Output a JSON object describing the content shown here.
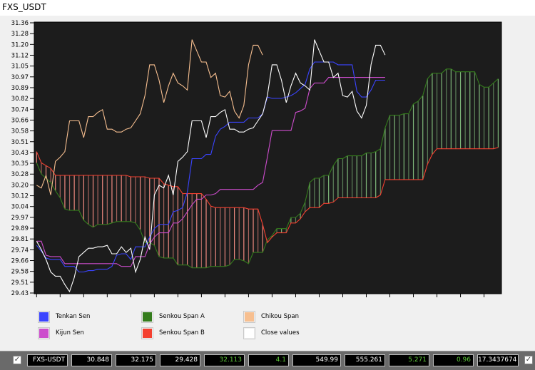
{
  "window": {
    "title": "FXS_USDT"
  },
  "colors": {
    "tenkan": "#3a44ff",
    "kijun": "#cc4ccc",
    "senkou_a": "#347c1c",
    "senkou_b": "#f44030",
    "chikou": "#f7bf90",
    "close": "#ffffff",
    "plot_bg": "#1c1c1c",
    "cloud_bullish": "#7fb87a",
    "cloud_bearish": "#f08a80",
    "value_green": "#5ec83a"
  },
  "chart_data": {
    "type": "line",
    "title": "",
    "xlabel": "",
    "ylabel": "",
    "xlim": [
      -0.5,
      98.7
    ],
    "ylim": [
      29.43,
      31.36
    ],
    "grid": false,
    "legend_placement": "bottom",
    "x_ticks": [
      "0",
      "5",
      "10",
      "15",
      "20",
      "25",
      "30",
      "35",
      "40",
      "45",
      "50",
      "55",
      "60",
      "65",
      "70",
      "75",
      "80",
      "85",
      "90",
      "95"
    ],
    "y_ticks": [
      "31.36",
      "31.28",
      "31.20",
      "31.12",
      "31.05",
      "30.97",
      "30.89",
      "30.82",
      "30.74",
      "30.66",
      "30.58",
      "30.51",
      "30.43",
      "30.35",
      "30.28",
      "30.20",
      "30.12",
      "30.04",
      "29.97",
      "29.89",
      "29.81",
      "29.74",
      "29.66",
      "29.58",
      "29.51",
      "29.43"
    ],
    "series": [
      {
        "name": "Tenkan Sen",
        "key": "tenkan",
        "x_start": 0,
        "values": [
          29.77,
          29.73,
          29.68,
          29.67,
          29.67,
          29.67,
          29.62,
          29.62,
          29.62,
          29.58,
          29.58,
          29.59,
          29.59,
          29.6,
          29.6,
          29.6,
          29.62,
          29.7,
          29.71,
          29.71,
          29.67,
          29.76,
          29.76,
          29.76,
          29.83,
          29.89,
          29.92,
          29.92,
          29.92,
          30.01,
          30.02,
          30.04,
          30.15,
          30.39,
          30.39,
          30.39,
          30.42,
          30.42,
          30.55,
          30.6,
          30.62,
          30.65,
          30.65,
          30.65,
          30.65,
          30.68,
          30.68,
          30.68,
          30.71,
          30.83,
          30.82,
          30.82,
          30.82,
          30.83,
          30.84,
          30.86,
          30.89,
          30.92,
          31.03,
          31.08,
          31.08,
          31.08,
          31.08,
          31.08,
          31.06,
          31.06,
          31.06,
          31.06,
          30.87,
          30.83,
          30.83,
          30.88,
          30.95,
          30.95,
          30.95
        ]
      },
      {
        "name": "Kijun Sen",
        "key": "kijun",
        "x_start": 0,
        "values": [
          29.8,
          29.8,
          29.7,
          29.69,
          29.69,
          29.69,
          29.64,
          29.64,
          29.64,
          29.64,
          29.64,
          29.64,
          29.64,
          29.64,
          29.64,
          29.64,
          29.64,
          29.64,
          29.62,
          29.62,
          29.62,
          29.69,
          29.69,
          29.69,
          29.78,
          29.83,
          29.86,
          29.86,
          29.86,
          29.93,
          29.93,
          29.96,
          30.01,
          30.06,
          30.1,
          30.1,
          30.13,
          30.13,
          30.14,
          30.17,
          30.17,
          30.17,
          30.17,
          30.17,
          30.17,
          30.17,
          30.17,
          30.2,
          30.22,
          30.4,
          30.59,
          30.59,
          30.59,
          30.59,
          30.59,
          30.72,
          30.73,
          30.75,
          30.89,
          30.93,
          30.93,
          30.93,
          30.97,
          30.97,
          30.97,
          30.97,
          30.97,
          30.97,
          30.97,
          30.97,
          30.97,
          30.97,
          30.97,
          30.97,
          30.97
        ]
      },
      {
        "name": "Senkou Span A",
        "key": "senkou_a",
        "x_start": 0,
        "values": [
          30.36,
          30.28,
          30.25,
          30.22,
          30.16,
          30.11,
          30.03,
          30.02,
          30.02,
          30.02,
          29.95,
          29.92,
          29.9,
          29.92,
          29.92,
          29.92,
          29.93,
          29.94,
          29.94,
          29.94,
          29.94,
          29.93,
          29.88,
          29.79,
          29.79,
          29.77,
          29.69,
          29.68,
          29.68,
          29.68,
          29.63,
          29.63,
          29.63,
          29.61,
          29.61,
          29.61,
          29.61,
          29.62,
          29.62,
          29.62,
          29.62,
          29.63,
          29.67,
          29.67,
          29.66,
          29.64,
          29.72,
          29.72,
          29.72,
          29.81,
          29.84,
          29.89,
          29.89,
          29.89,
          29.97,
          29.97,
          30.0,
          30.08,
          30.22,
          30.25,
          30.25,
          30.27,
          30.27,
          30.34,
          30.39,
          30.39,
          30.41,
          30.41,
          30.41,
          30.41,
          30.43,
          30.43,
          30.44,
          30.46,
          30.61,
          30.7,
          30.7,
          30.7,
          30.71,
          30.71,
          30.78,
          30.8,
          30.84,
          30.96,
          31.0,
          31.0,
          31.0,
          31.03,
          31.03,
          31.01,
          31.01,
          31.01,
          31.01,
          31.01,
          30.92,
          30.9,
          30.9,
          30.93,
          30.96
        ]
      },
      {
        "name": "Senkou Span B",
        "key": "senkou_b",
        "x_start": 0,
        "values": [
          30.44,
          30.36,
          30.34,
          30.32,
          30.27,
          30.27,
          30.27,
          30.27,
          30.27,
          30.27,
          30.27,
          30.27,
          30.27,
          30.27,
          30.27,
          30.27,
          30.27,
          30.27,
          30.27,
          30.27,
          30.26,
          30.26,
          30.26,
          30.26,
          30.25,
          30.25,
          30.25,
          30.21,
          30.2,
          30.19,
          30.19,
          30.14,
          30.14,
          30.14,
          30.14,
          30.14,
          30.1,
          30.05,
          30.04,
          30.04,
          30.04,
          30.04,
          30.04,
          30.04,
          30.04,
          30.03,
          30.03,
          30.03,
          29.92,
          29.79,
          29.83,
          29.86,
          29.86,
          29.86,
          29.93,
          29.93,
          29.96,
          30.01,
          30.04,
          30.04,
          30.04,
          30.07,
          30.07,
          30.08,
          30.11,
          30.11,
          30.11,
          30.11,
          30.11,
          30.11,
          30.11,
          30.11,
          30.11,
          30.13,
          30.24,
          30.24,
          30.24,
          30.24,
          30.24,
          30.24,
          30.24,
          30.24,
          30.24,
          30.35,
          30.42,
          30.46,
          30.46,
          30.46,
          30.46,
          30.46,
          30.46,
          30.46,
          30.46,
          30.46,
          30.46,
          30.46,
          30.46,
          30.46,
          30.47
        ]
      },
      {
        "name": "Chikou Span",
        "key": "chikou",
        "x_start": 0,
        "values": [
          30.2,
          30.18,
          30.27,
          30.13,
          30.37,
          30.4,
          30.44,
          30.66,
          30.66,
          30.66,
          30.54,
          30.69,
          30.69,
          30.72,
          30.74,
          30.6,
          30.6,
          30.58,
          30.58,
          30.6,
          30.61,
          30.66,
          30.71,
          30.84,
          31.06,
          31.06,
          30.95,
          30.79,
          30.91,
          31.0,
          30.93,
          30.91,
          30.88,
          31.24,
          31.16,
          31.08,
          31.08,
          30.97,
          31.0,
          30.84,
          30.83,
          30.87,
          30.73,
          30.68,
          30.77,
          31.06,
          31.2,
          31.2,
          31.13
        ]
      },
      {
        "name": "Close values",
        "key": "close",
        "x_start": 0,
        "values": [
          29.8,
          29.74,
          29.67,
          29.58,
          29.55,
          29.55,
          29.49,
          29.44,
          29.54,
          29.69,
          29.72,
          29.75,
          29.75,
          29.76,
          29.76,
          29.77,
          29.71,
          29.71,
          29.76,
          29.72,
          29.75,
          29.58,
          29.67,
          29.83,
          29.74,
          30.13,
          30.2,
          30.18,
          30.27,
          30.13,
          30.37,
          30.4,
          30.44,
          30.66,
          30.66,
          30.66,
          30.54,
          30.69,
          30.69,
          30.72,
          30.74,
          30.6,
          30.6,
          30.58,
          30.58,
          30.6,
          30.61,
          30.66,
          30.71,
          30.84,
          31.06,
          31.06,
          30.95,
          30.79,
          30.91,
          31.0,
          30.93,
          30.91,
          30.88,
          31.24,
          31.16,
          31.08,
          31.08,
          30.97,
          31.0,
          30.84,
          30.83,
          30.87,
          30.73,
          30.68,
          30.77,
          31.06,
          31.2,
          31.2,
          31.13
        ]
      }
    ]
  },
  "legend": [
    {
      "label": "Tenkan Sen",
      "key": "tenkan"
    },
    {
      "label": "Kijun Sen",
      "key": "kijun"
    },
    {
      "label": "Senkou Span A",
      "key": "senkou_a"
    },
    {
      "label": "Senkou Span B",
      "key": "senkou_b"
    },
    {
      "label": "Chikou Span",
      "key": "chikou"
    },
    {
      "label": "Close values",
      "key": "close"
    }
  ],
  "bottom_bar": {
    "left_checkbox_checked": true,
    "right_checkbox_checked": true,
    "fields": [
      {
        "value": "FXS-USDT",
        "green": false
      },
      {
        "value": "30.848",
        "green": false
      },
      {
        "value": "32.175",
        "green": false
      },
      {
        "value": "29.428",
        "green": false
      },
      {
        "value": "32.113",
        "green": true
      },
      {
        "value": "4.1",
        "green": true
      },
      {
        "value": "549.99",
        "green": false
      },
      {
        "value": "555.261",
        "green": false
      },
      {
        "value": "5.271",
        "green": true
      },
      {
        "value": "0.96",
        "green": true
      },
      {
        "value": "17.3437674",
        "green": false
      }
    ]
  }
}
